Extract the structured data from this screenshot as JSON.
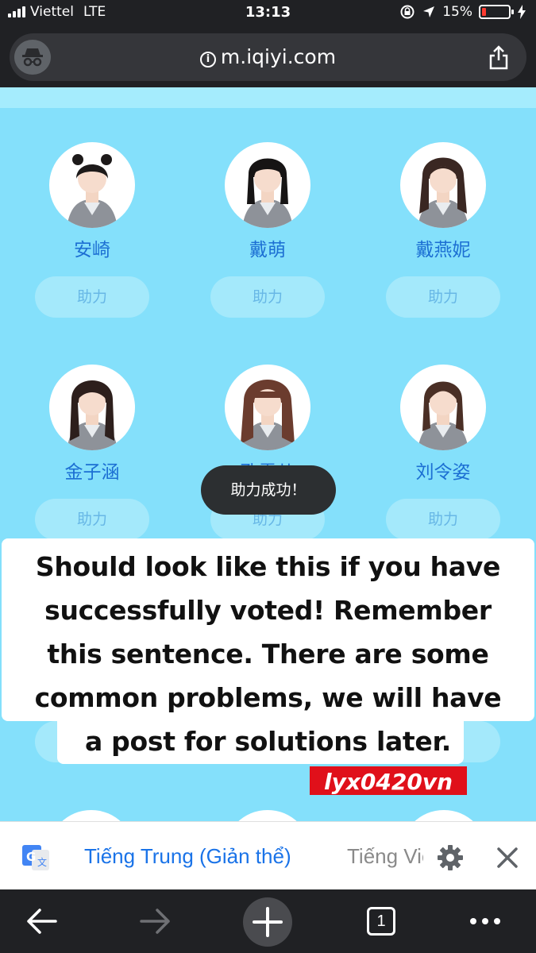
{
  "status_bar": {
    "carrier": "Viettel",
    "network": "LTE",
    "time": "13:13",
    "battery_percent": "15%",
    "battery_level": 0.15
  },
  "browser": {
    "url": "m.iqiyi.com",
    "tab_count": "1"
  },
  "members": [
    {
      "name": "安崎",
      "vote_label": "助力"
    },
    {
      "name": "戴萌",
      "vote_label": "助力"
    },
    {
      "name": "戴燕妮",
      "vote_label": "助力"
    },
    {
      "name": "金子涵",
      "vote_label": "助力"
    },
    {
      "name": "孔雪儿",
      "vote_label": "助力"
    },
    {
      "name": "刘令姿",
      "vote_label": "助力"
    }
  ],
  "toast": "助力成功！",
  "caption": {
    "lines": [
      "Should look like this if you have",
      "successfully voted! Remember",
      "this sentence. There are some",
      "common problems, we will have",
      "a post for solutions later."
    ],
    "watermark": "lyx0420vn"
  },
  "translate_bar": {
    "active_language": "Tiếng Trung (Giản thể)",
    "other_language": "Tiếng Việt"
  },
  "colors": {
    "page_bg": "#84e0fb",
    "name_blue": "#1c6fd3",
    "translate_blue": "#1a73e8",
    "watermark_red": "#e0101a"
  }
}
